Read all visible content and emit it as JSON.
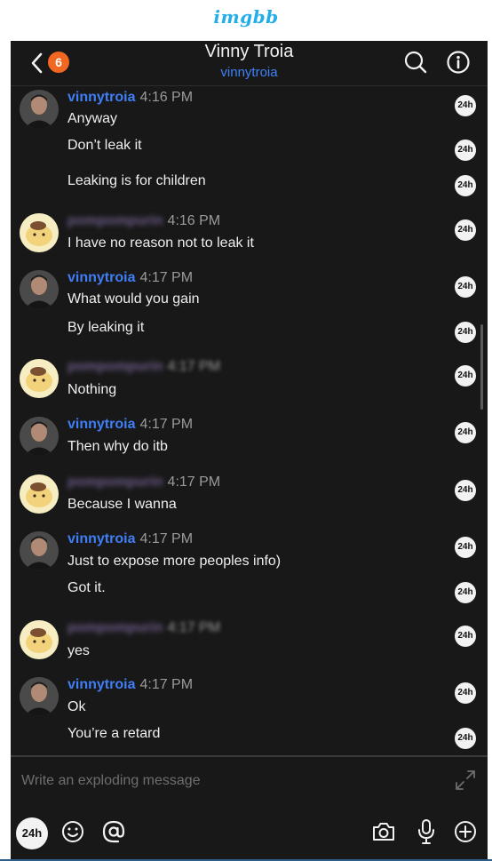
{
  "brand": {
    "logo_text": "imgbb",
    "color": "#22aee8"
  },
  "header": {
    "unread_count": "6",
    "title": "Vinny Troia",
    "subtitle": "vinnytroia",
    "icons": [
      "back-chevron-icon",
      "search-icon",
      "info-icon"
    ]
  },
  "messages": [
    {
      "sender": "vinnytroia",
      "time": "4:16 PM",
      "text": "Anyway",
      "timer": "24h",
      "redacted": false
    },
    {
      "text": "Don’t leak it",
      "timer": "24h"
    },
    {
      "text": "Leaking is for children",
      "timer": "24h"
    },
    {
      "sender": "pompompurin",
      "time": "4:16 PM",
      "text": "I have no reason not to leak it",
      "timer": "24h",
      "redacted": true
    },
    {
      "sender": "vinnytroia",
      "time": "4:17 PM",
      "text": "What would you gain",
      "timer": "24h",
      "redacted": false
    },
    {
      "text": "By leaking it",
      "timer": "24h"
    },
    {
      "sender": "pompompurin",
      "time": "4:17 PM",
      "text": "Nothing",
      "timer": "24h",
      "redacted": true
    },
    {
      "sender": "vinnytroia",
      "time": "4:17 PM",
      "text": "Then why do itb",
      "timer": "24h",
      "redacted": false
    },
    {
      "sender": "pompompurin",
      "time": "4:17 PM",
      "text": "Because I wanna",
      "timer": "24h",
      "redacted": true
    },
    {
      "sender": "vinnytroia",
      "time": "4:17 PM",
      "text": "Just to expose more peoples info)",
      "timer": "24h",
      "redacted": false
    },
    {
      "text": "Got it.",
      "timer": "24h"
    },
    {
      "sender": "pompompurin",
      "time": "4:17 PM",
      "text": "yes",
      "timer": "24h",
      "redacted": true
    },
    {
      "sender": "vinnytroia",
      "time": "4:17 PM",
      "text": "Ok",
      "timer": "24h",
      "redacted": false
    },
    {
      "text": "You’re a retard",
      "timer": "24h"
    }
  ],
  "composer": {
    "placeholder": "Write an exploding message",
    "timer_label": "24h",
    "icons": [
      "expand-icon",
      "emoji-icon",
      "mention-icon",
      "camera-icon",
      "microphone-icon",
      "add-icon"
    ]
  },
  "colors": {
    "background": "#181818",
    "accent_blue": "#3f7ef5",
    "badge_orange": "#f26722",
    "timer_bg": "#f2f2f2"
  }
}
